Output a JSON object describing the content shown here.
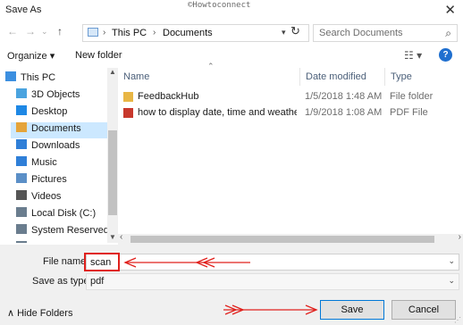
{
  "window": {
    "title": "Save As",
    "watermark": "©Howtoconnect",
    "close_glyph": "✕"
  },
  "address": {
    "crumbs": [
      "This PC",
      "Documents"
    ],
    "separator": "›",
    "search_placeholder": "Search Documents"
  },
  "toolbar": {
    "organize": "Organize ▾",
    "new_folder": "New folder",
    "help": "?"
  },
  "nav": {
    "items": [
      {
        "label": "This PC",
        "icon": "computer-icon",
        "color": "#3c8fe0"
      },
      {
        "label": "3D Objects",
        "icon": "cube-icon",
        "color": "#4aa3df"
      },
      {
        "label": "Desktop",
        "icon": "desktop-icon",
        "color": "#1e88e5"
      },
      {
        "label": "Documents",
        "icon": "document-icon",
        "color": "#e5a43a",
        "selected": true
      },
      {
        "label": "Downloads",
        "icon": "download-icon",
        "color": "#2f7fd8"
      },
      {
        "label": "Music",
        "icon": "music-icon",
        "color": "#2f7fd8"
      },
      {
        "label": "Pictures",
        "icon": "pictures-icon",
        "color": "#5b8fc7"
      },
      {
        "label": "Videos",
        "icon": "videos-icon",
        "color": "#555555"
      },
      {
        "label": "Local Disk (C:)",
        "icon": "drive-icon",
        "color": "#6a7d8e"
      },
      {
        "label": "System Reserved",
        "icon": "drive-icon",
        "color": "#6a7d8e"
      },
      {
        "label": "Local Disk (E:)",
        "icon": "drive-icon",
        "color": "#6a7d8e"
      }
    ]
  },
  "files": {
    "columns": [
      "Name",
      "Date modified",
      "Type"
    ],
    "rows": [
      {
        "name": "FeedbackHub",
        "date": "1/5/2018 1:48 AM",
        "type": "File folder",
        "icon": "folder-icon"
      },
      {
        "name": "how to display date, time and weather in ...",
        "date": "1/9/2018 1:08 AM",
        "type": "PDF File",
        "icon": "pdf-icon"
      }
    ]
  },
  "form": {
    "file_name_label": "File name:",
    "file_name_value": "scan",
    "save_type_label": "Save as type:",
    "save_type_value": "pdf"
  },
  "footer": {
    "hide_folders": "∧  Hide Folders",
    "save": "Save",
    "cancel": "Cancel"
  },
  "colors": {
    "annotation": "#e0201c",
    "selection": "#cce8ff",
    "accent": "#0078d7"
  }
}
